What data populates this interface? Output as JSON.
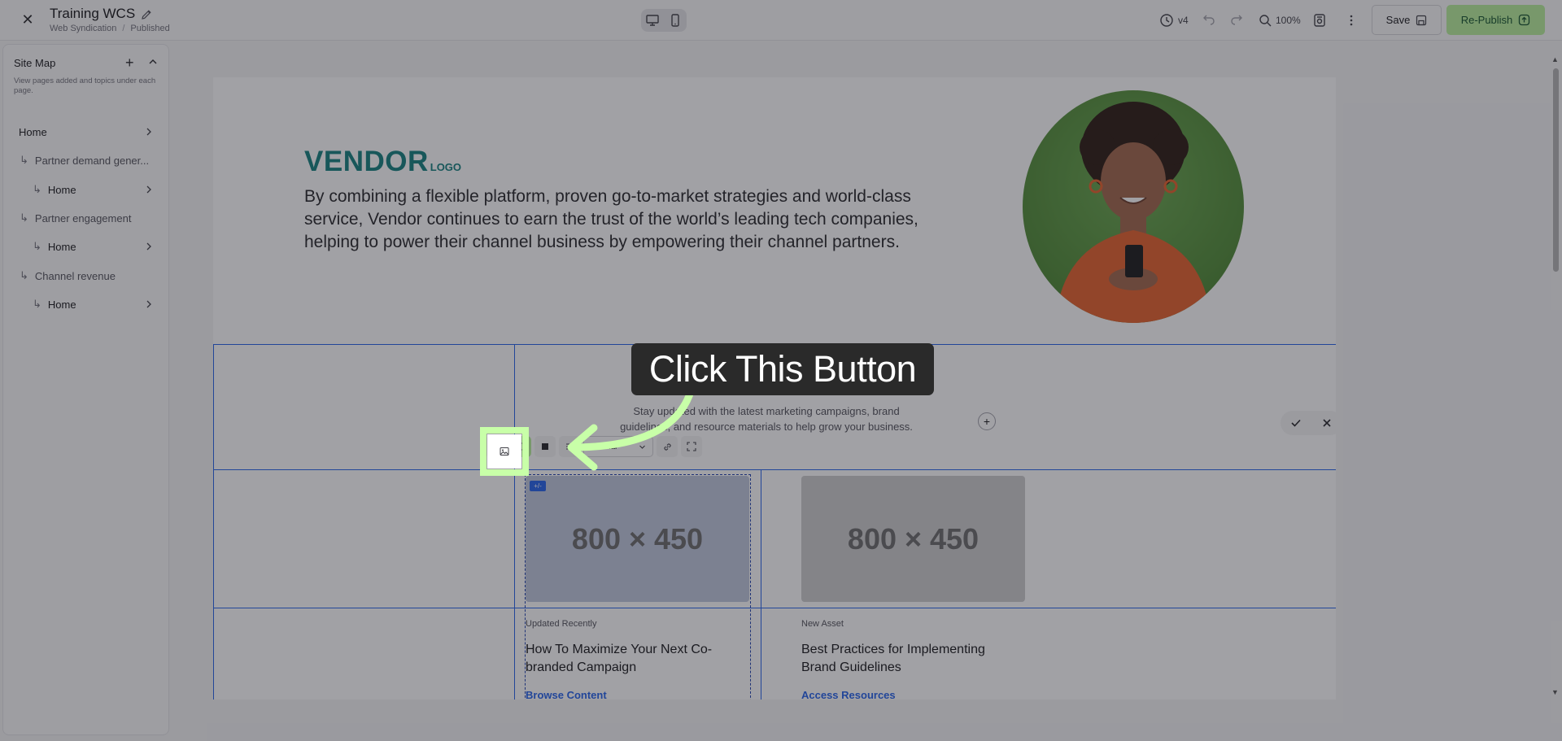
{
  "header": {
    "title": "Training WCS",
    "breadcrumb_1": "Web Syndication",
    "breadcrumb_sep": "/",
    "breadcrumb_2": "Published",
    "version": "v4",
    "zoom": "100%",
    "save_label": "Save",
    "republish_label": "Re-Publish"
  },
  "sitemap": {
    "title": "Site Map",
    "description": "View pages added and topics under each page.",
    "items": [
      {
        "label": "Home",
        "level": 0
      },
      {
        "label": "Partner demand gener...",
        "level": 1
      },
      {
        "label": "Home",
        "level": 2
      },
      {
        "label": "Partner engagement",
        "level": 1
      },
      {
        "label": "Home",
        "level": 2
      },
      {
        "label": "Channel revenue",
        "level": 1
      },
      {
        "label": "Home",
        "level": 2
      }
    ]
  },
  "hero": {
    "logo_main": "VENDOR",
    "logo_sub": "LOGO",
    "text": "By combining a flexible platform, proven go-to-market strategies and world-class service, Vendor continues to earn the trust of the world’s leading tech companies, helping to power their channel business by empowering their channel partners."
  },
  "section": {
    "subtitle": "Stay updated with the latest marketing campaigns, brand guidelines, and resource materials to help grow your business."
  },
  "toolbar": {
    "style_select": "Normal"
  },
  "cards": [
    {
      "placeholder": "800 × 450",
      "tag": "Updated Recently",
      "title": "How To Maximize Your Next Co-branded Campaign",
      "link": "Browse Content"
    },
    {
      "placeholder": "800 × 450",
      "tag": "New Asset",
      "title": "Best Practices for Implementing Brand Guidelines",
      "link": "Access Resources"
    }
  ],
  "overlay": {
    "callout": "Click This Button",
    "highlight_color": "#c8ffa8"
  },
  "colors": {
    "brand_teal": "#14807f",
    "accent_blue": "#2563eb",
    "republish_green": "#b8f09c"
  }
}
